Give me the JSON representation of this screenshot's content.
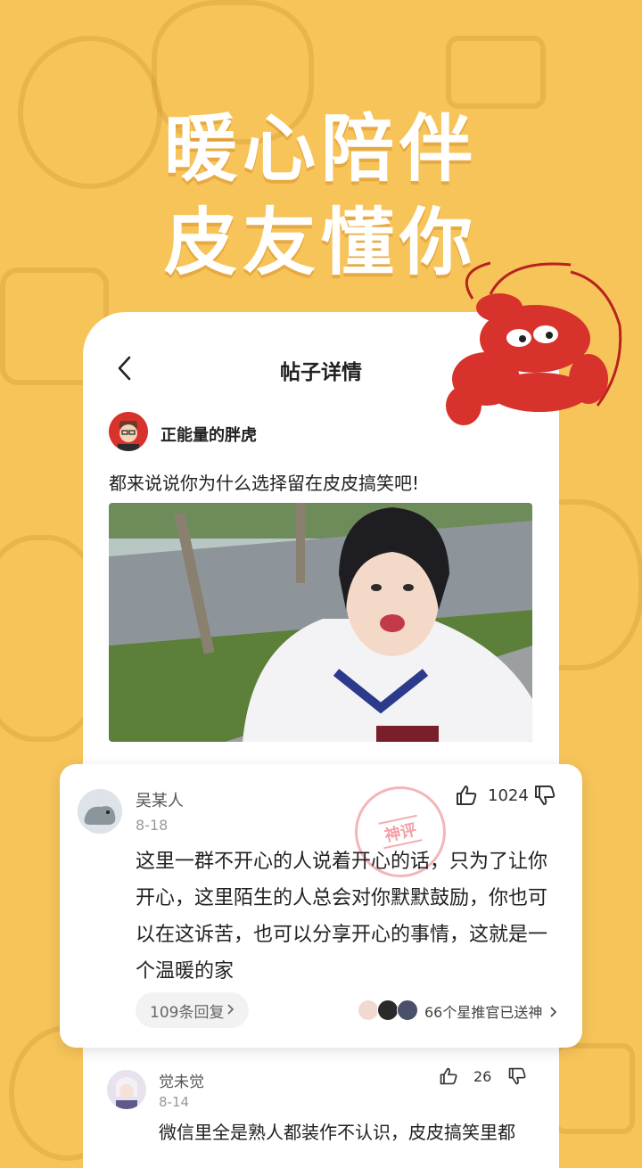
{
  "headline": {
    "line1": "暖心陪伴",
    "line2": "皮友懂你"
  },
  "nav": {
    "title": "帖子详情"
  },
  "post": {
    "author": "正能量的胖虎",
    "text": "都来说说你为什么选择留在皮皮搞笑吧!"
  },
  "comment": {
    "name": "吴某人",
    "date": "8-18",
    "likes": "1024",
    "stamp": "神评",
    "body": "这里一群不开心的人说着开心的话，只为了让你开心，这里陌生的人总会对你默默鼓励，你也可以在这诉苦，也可以分享开心的事情，这就是一个温暖的家",
    "replies": "109条回复",
    "star_text": "66个星推官已送神"
  },
  "comment2": {
    "name": "觉未觉",
    "date": "8-14",
    "likes": "26",
    "body": "微信里全是熟人都装作不认识，皮皮搞笑里都"
  },
  "colors": {
    "background": "#F7C45A",
    "card": "#FFFFFF",
    "lobster": "#D8322C"
  }
}
